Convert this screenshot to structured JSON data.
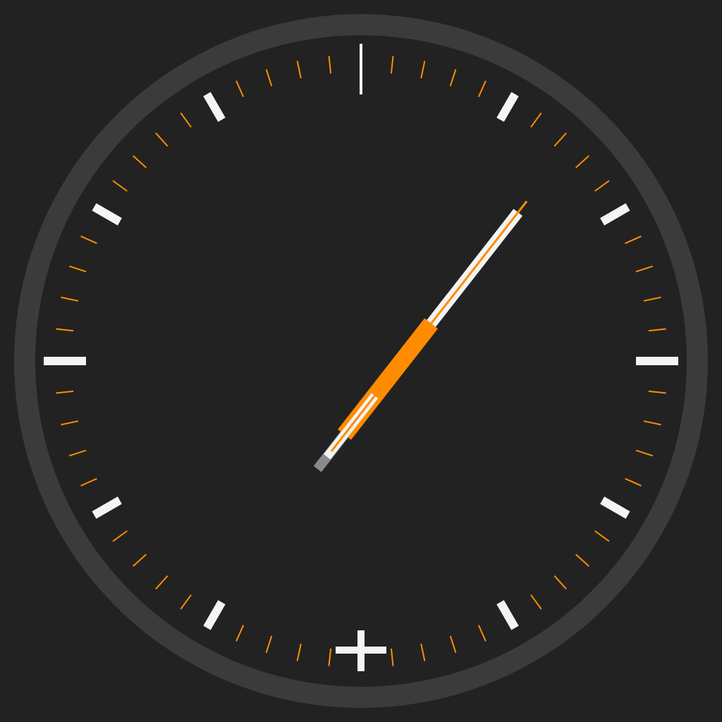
{
  "colors": {
    "background": "#222222",
    "bezel": "#3b3b3b",
    "dial": "#222222",
    "accent": "#ff8c00",
    "major_marker": "#f4f4f4",
    "hand_tail": "#8a8a8a"
  },
  "dial": {
    "minute_tick_count": 60,
    "major_marker_count": 12
  },
  "time": {
    "hours": 1,
    "minutes": 7,
    "seconds": 7
  },
  "icons": {
    "bottom_marker": "plus-icon"
  }
}
